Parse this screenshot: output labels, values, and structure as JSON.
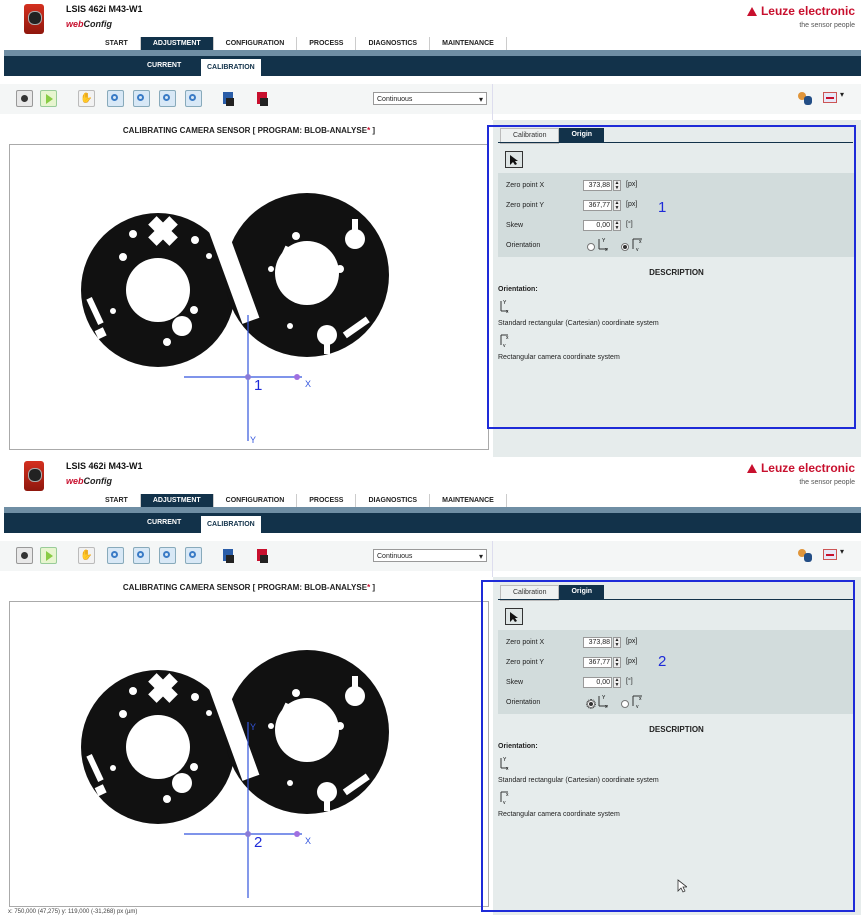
{
  "header": {
    "device_title": "LSIS 462i M43-W1",
    "web_prefix": "web",
    "web_suffix": "Config",
    "brand": "Leuze electronic",
    "tagline": "the sensor people"
  },
  "nav": {
    "tabs": [
      "START",
      "ADJUSTMENT",
      "CONFIGURATION",
      "PROCESS",
      "DIAGNOSTICS",
      "MAINTENANCE"
    ],
    "active": "ADJUSTMENT"
  },
  "subnav": {
    "current": "CURRENT",
    "calibration": "CALIBRATION"
  },
  "toolbar": {
    "mode_select": "Continuous",
    "icons": [
      "camera-icon",
      "play-icon",
      "hand-icon",
      "zoom-in-icon",
      "zoom-out-icon",
      "zoom-fit-icon",
      "zoom-reset-icon",
      "save-icon",
      "save-red-icon",
      "user-icon",
      "language-flag-icon"
    ]
  },
  "main": {
    "title": "CALIBRATING CAMERA SENSOR   [ PROGRAM: BLOB-ANALYSE",
    "title_star": "*",
    "title_close": "]"
  },
  "panel": {
    "tab_calibration": "Calibration",
    "tab_origin": "Origin",
    "zero_x_label": "Zero point X",
    "zero_y_label": "Zero point Y",
    "skew_label": "Skew",
    "orientation_label": "Orientation",
    "unit_px": "[px]",
    "unit_deg": "[°]",
    "description_title": "DESCRIPTION",
    "orientation_heading": "Orientation:",
    "desc_cartesian": "Standard rectangular (Cartesian) coordinate system",
    "desc_camera": "Rectangular camera coordinate system"
  },
  "states": [
    {
      "zero_x": "373,88",
      "zero_y": "367,77",
      "skew": "0,00",
      "orientation": "camera",
      "marker": "1"
    },
    {
      "zero_x": "373,88",
      "zero_y": "367,77",
      "skew": "0,00",
      "orientation": "cartesian",
      "marker": "2"
    }
  ],
  "status": {
    "coords": "x: 750,000 (47,275) y: 119,000 (-31,268) px (µm)"
  }
}
